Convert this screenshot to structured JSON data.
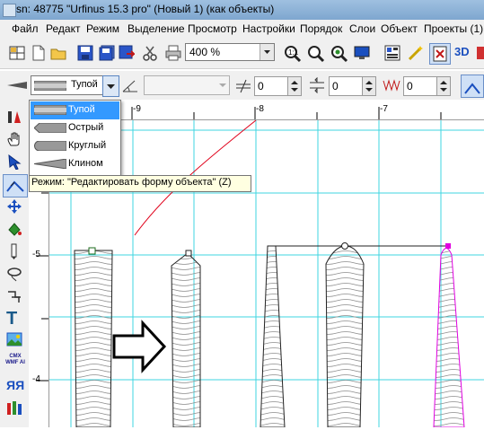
{
  "window": {
    "title": "sn: 48775 \"Urfinus 15.3 pro\" (Новый 1) (как объекты)"
  },
  "menu": [
    "Файл",
    "Редакт",
    "Режим",
    "Выделение",
    "Просмотр",
    "Настройки",
    "Порядок",
    "Слои",
    "Объект",
    "Проекты (1)"
  ],
  "toolbar": {
    "zoom_value": "400 %",
    "label_3d": "3D"
  },
  "toolbar2": {
    "outline_style_value": "Тупой",
    "field1_value": "0",
    "field2_value": "0",
    "field3_value": "0"
  },
  "ruler": {
    "top_ticks": [
      "-9",
      "-8",
      "-7"
    ],
    "left_ticks": [
      "-5",
      "-4"
    ]
  },
  "dropdown": {
    "items": [
      "Тупой",
      "Острый",
      "Круглый",
      "Клином"
    ],
    "selected_index": 0
  },
  "tooltip": {
    "text": "Режим: \"Редактировать форму объекта\" (Z)"
  },
  "left_tools": [
    "select-tool",
    "hand-tool",
    "arrow-tool",
    "edit-shape-tool",
    "move-tool",
    "fill-tool",
    "pencil-tool",
    "lasso-tool",
    "transform-tool",
    "text-tool",
    "image-tool",
    "cmx-wmf-ai-tool",
    "letters-tool",
    "colors-tool"
  ],
  "left_tool_labels": {
    "cmx": "CMX WMF AI",
    "letters": "ЯЯ"
  },
  "colors": {
    "accent": "#1f5fbf",
    "grid": "#00d8e0",
    "curve": "#e0001a",
    "magenta": "#e000e0",
    "toolbar_bg": "#f0f0f0"
  }
}
